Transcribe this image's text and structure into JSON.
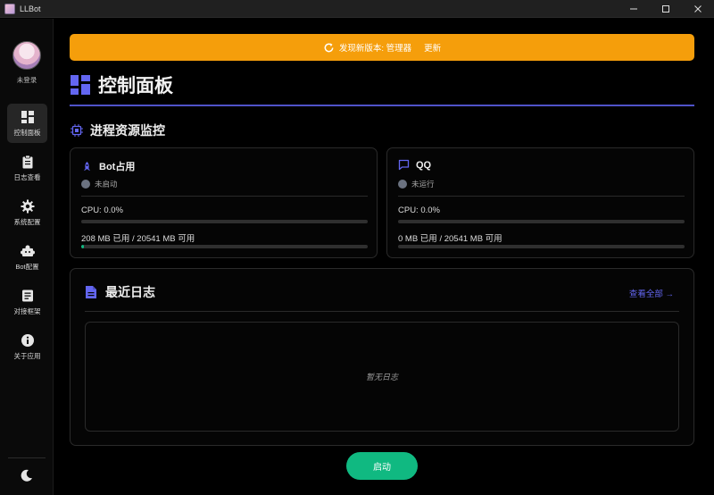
{
  "window": {
    "title": "LLBot",
    "controls": [
      "minimize-icon",
      "maximize-icon",
      "close-icon"
    ]
  },
  "sidebar": {
    "user_label": "未登录",
    "items": [
      {
        "label": "控制面板",
        "icon": "dashboard-icon",
        "active": true
      },
      {
        "label": "日志查看",
        "icon": "clipboard-icon",
        "active": false
      },
      {
        "label": "系统配置",
        "icon": "gear-icon",
        "active": false
      },
      {
        "label": "Bot配置",
        "icon": "puzzle-icon",
        "active": false
      },
      {
        "label": "对接框架",
        "icon": "list-doc-icon",
        "active": false
      },
      {
        "label": "关于应用",
        "icon": "info-icon",
        "active": false
      }
    ],
    "theme_icon": "moon-icon"
  },
  "banner": {
    "text": "发现新版本: 管理器",
    "action": "更新",
    "color": "#f59e0b"
  },
  "page": {
    "title": "控制面板",
    "section_title": "进程资源监控",
    "accent": "#4f52c8"
  },
  "cards": {
    "bot": {
      "name": "Bot占用",
      "status": "未启动",
      "cpu": "CPU: 0.0%",
      "cpu_fraction": 0.0,
      "memory": "208 MB 已用 / 20541 MB 可用",
      "memory_fraction": 0.0101
    },
    "qq": {
      "name": "QQ",
      "status": "未运行",
      "cpu": "CPU: 0.0%",
      "cpu_fraction": 0.0,
      "memory": "0 MB 已用 / 20541 MB 可用",
      "memory_fraction": 0.0
    }
  },
  "logs": {
    "title": "最近日志",
    "view_all": "查看全部 →",
    "empty": "暂无日志"
  },
  "start_button": {
    "label": "启动",
    "color": "#10b981"
  }
}
